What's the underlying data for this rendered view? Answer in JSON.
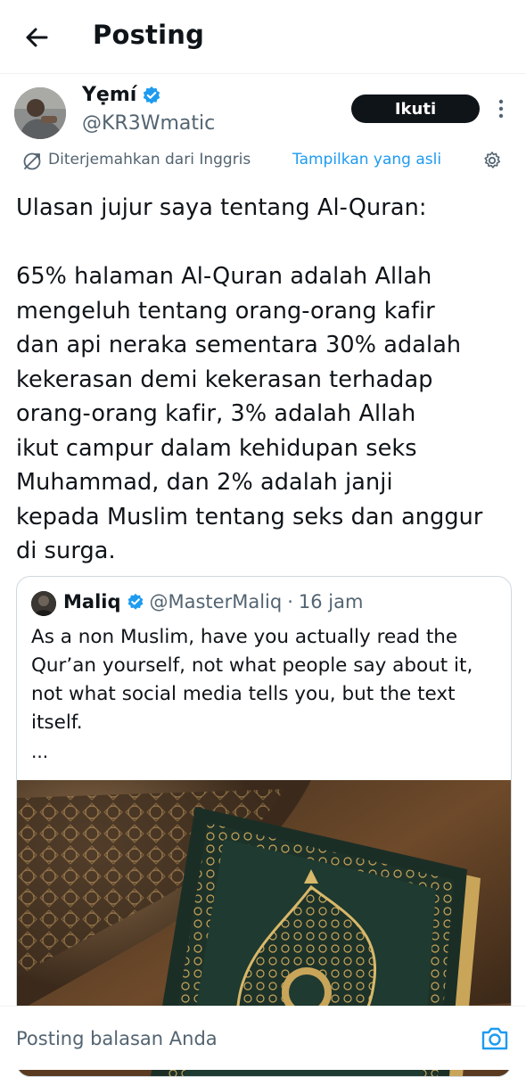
{
  "header": {
    "title": "Posting",
    "back_icon": "arrow-left-icon"
  },
  "author": {
    "name": "Yẹmí",
    "handle": "@KR3Wmatic",
    "verified": true,
    "avatar_icon": "avatar-photo",
    "follow_label": "Ikuti"
  },
  "translation": {
    "note": "Diterjemahkan dari Inggris",
    "show_original": "Tampilkan yang asli",
    "gear_icon": "gear-icon"
  },
  "post": {
    "text": "Ulasan jujur saya tentang Al-Quran:\n\n65% halaman Al-Quran adalah Allah\nmengeluh tentang orang-orang kafir\ndan api neraka sementara 30% adalah\nkekerasan demi kekerasan terhadap\norang-orang kafir, 3% adalah Allah\nikut campur dalam kehidupan seks\nMuhammad, dan 2% adalah janji\nkepada Muslim tentang seks dan anggur\ndi surga."
  },
  "quoted_post": {
    "name": "Maliq",
    "handle": "@MasterMaliq",
    "separator": "·",
    "time": "16 jam",
    "verified": true,
    "text": "As a non Muslim, have you actually read the Qur’an yourself, not what people say about it, not what social media tells you, but the text itself.",
    "ellipsis": "...",
    "image": "quran-book-image"
  },
  "reply": {
    "placeholder": "Posting balasan Anda",
    "camera_icon": "camera-icon"
  },
  "colors": {
    "accent": "#1d9bf0",
    "text": "#0f1419",
    "secondary": "#536471",
    "follow_bg": "#0f1419",
    "border": "#cfd9de"
  }
}
